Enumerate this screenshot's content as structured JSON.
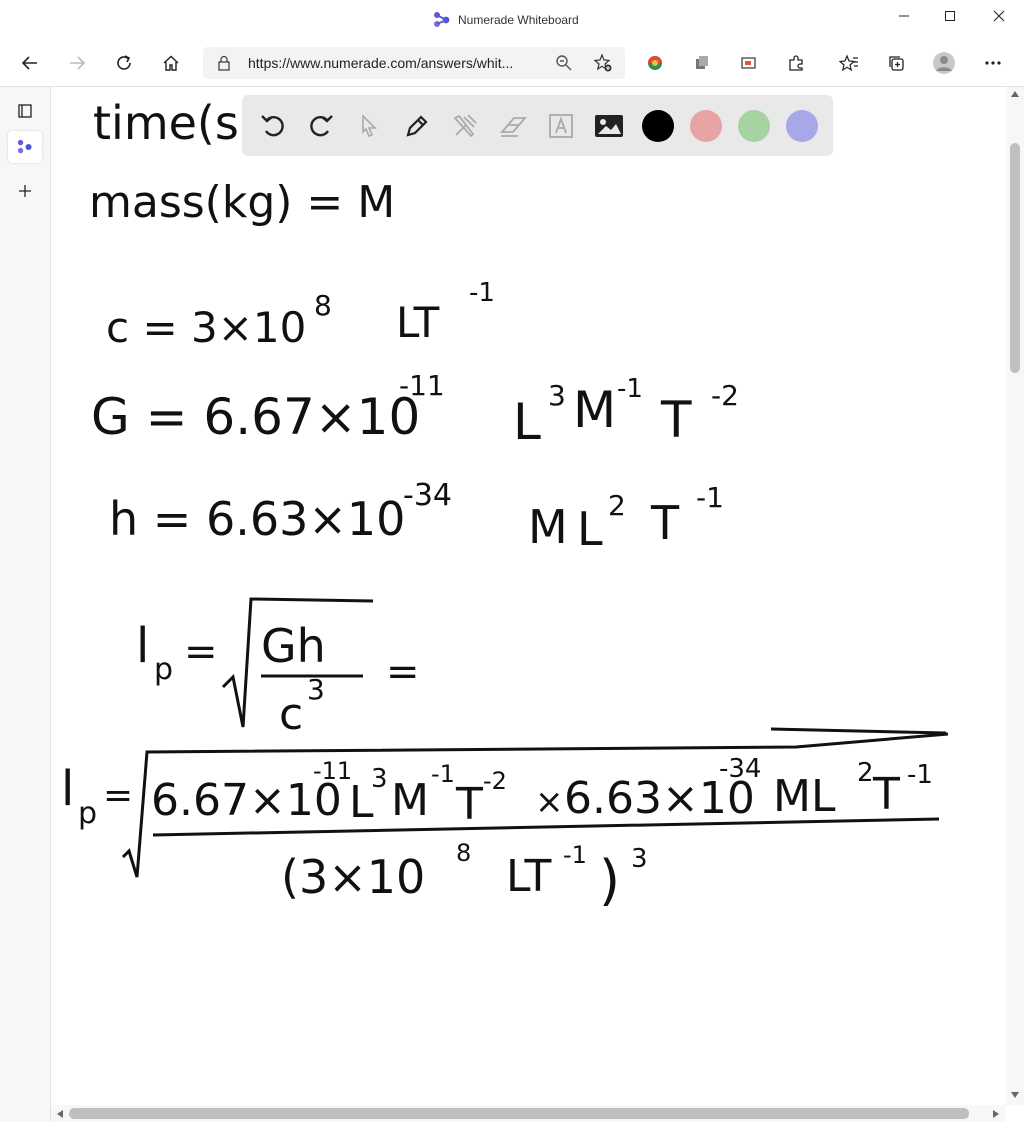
{
  "window": {
    "title": "Numerade Whiteboard",
    "app_icon": "numerade-logo-icon",
    "controls": [
      "minimize-icon",
      "maximize-icon",
      "close-icon"
    ]
  },
  "browser": {
    "url": "https://www.numerade.com/answers/whit...",
    "nav_icons": [
      "back-icon",
      "forward-icon",
      "refresh-icon",
      "home-icon"
    ],
    "url_icons": [
      "lock-icon",
      "zoom-icon",
      "add-favorite-icon"
    ],
    "extension_icons": [
      "extension-color-icon",
      "extension-cube-icon",
      "extension-screen-icon",
      "extensions-puzzle-icon",
      "favorites-icon",
      "collections-icon",
      "profile-avatar-icon",
      "more-icon"
    ]
  },
  "sidebar": {
    "items": [
      "tab-actions-icon",
      "numerade-tab-icon",
      "new-tab-icon"
    ]
  },
  "toolbar": {
    "tools": [
      "undo-icon",
      "redo-icon",
      "pointer-icon",
      "pen-icon",
      "tools-icon",
      "eraser-icon",
      "text-icon",
      "image-icon"
    ],
    "colors": [
      {
        "name": "black",
        "hex": "#000000"
      },
      {
        "name": "red",
        "hex": "#e8a4a4"
      },
      {
        "name": "green",
        "hex": "#a7d3a2"
      },
      {
        "name": "blue",
        "hex": "#a8a8e8"
      }
    ]
  },
  "handwriting": {
    "line1": "time(s",
    "line2": "mass(kg) = M",
    "c_lhs": "c = 3×10",
    "c_exp": "8",
    "c_unit": "LT",
    "c_unit_exp": "-1",
    "G_lhs": "G = 6.67×10",
    "G_exp": "-11",
    "G_L": "L",
    "G_L_exp": "3",
    "G_M": "M",
    "G_M_exp": "-1",
    "G_T": "T",
    "G_T_exp": "-2",
    "h_lhs": "h = 6.63×10",
    "h_exp": "-34",
    "h_M": "M",
    "h_L": "L",
    "h_L_exp": "2",
    "h_T": "T",
    "h_T_exp": "-1",
    "lp_label": "l",
    "lp_sub": "p",
    "lp_eq": "=",
    "lp_num": "Gh",
    "lp_den": "c",
    "lp_den_exp": "3",
    "lp_trail": "=",
    "big_num_1": "6.67×10",
    "big_num_1_exp": "-11",
    "big_num_L": "L",
    "big_num_L_exp": "3",
    "big_num_M": "M",
    "big_num_M_exp": "-1",
    "big_num_T": "T",
    "big_num_T_exp": "-2",
    "big_num_x": "×",
    "big_num_2": "6.63×10",
    "big_num_2_exp": "-34",
    "big_num_ML": "ML",
    "big_num_ML_exp": "2",
    "big_num_T2": "T",
    "big_num_T2_exp": "-1",
    "big_den": "(3×10",
    "big_den_exp": "8",
    "big_den_unit": "LT",
    "big_den_unit_exp": "-1",
    "big_den_close": ")",
    "big_den_close_exp": "3"
  }
}
